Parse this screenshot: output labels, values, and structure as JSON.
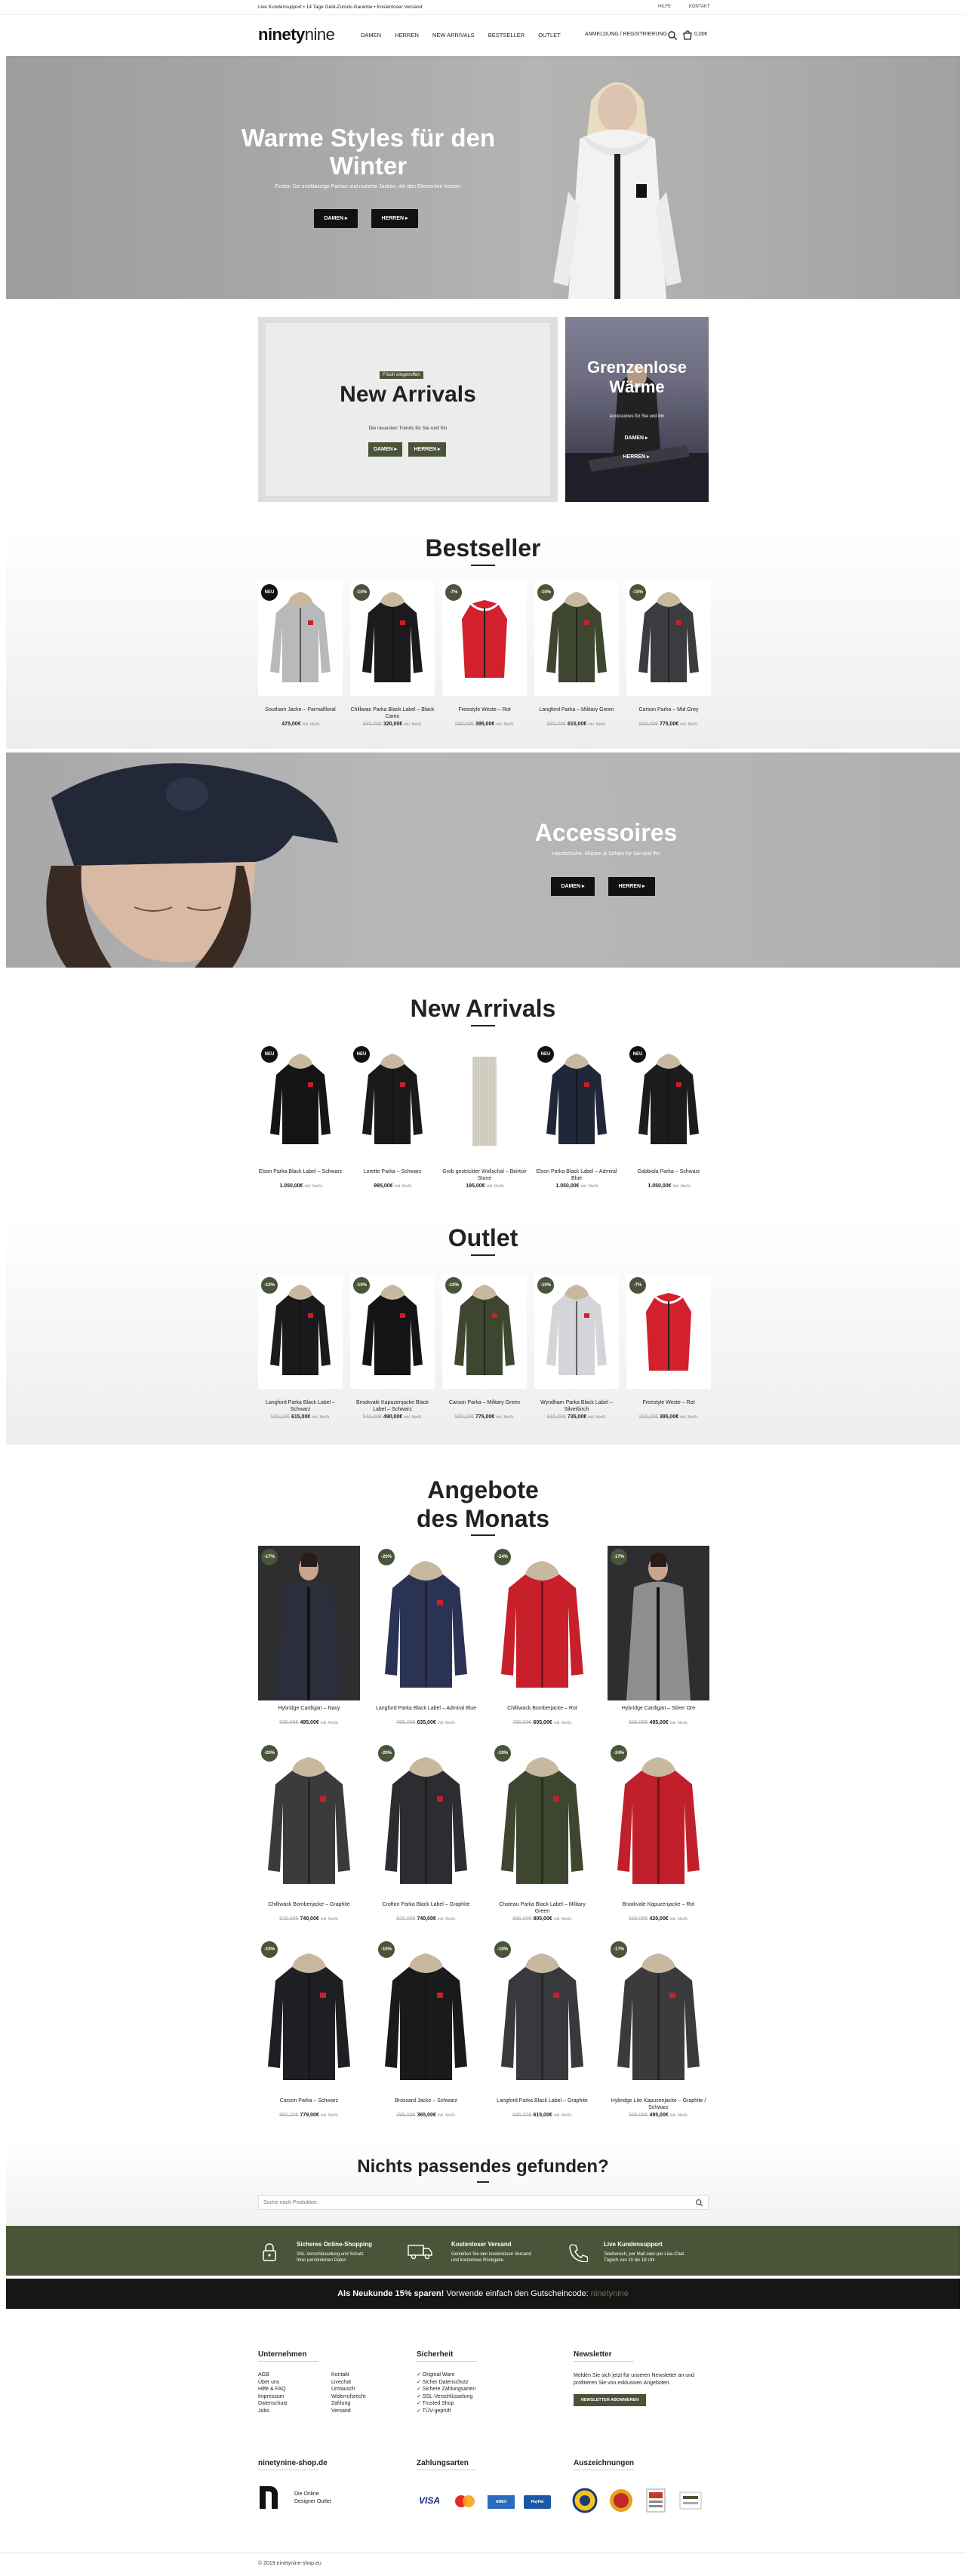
{
  "topbar": {
    "message": "Live Kundensupport • 14 Tage Geld-Zurück-Garantie • Kostenloser Versand",
    "link_help": "HILFE",
    "link_contact": "KONTAKT"
  },
  "header": {
    "logo_bold": "ninety",
    "logo_light": "nine",
    "nav": [
      "DAMEN",
      "HERREN",
      "NEW ARRIVALS",
      "BESTSELLER",
      "OUTLET"
    ],
    "account": "ANMELDUNG / REGISTRIERUNG",
    "cart_total": "0,00€"
  },
  "hero": {
    "title": "Warme Styles für den Winter",
    "subtitle": "Finden Sie erstklassige Parkas und isolierte Jacken, die den Elementen trotzen.",
    "btn_women": "DAMEN ▸",
    "btn_men": "HERREN ▸"
  },
  "new_arrivals_promo": {
    "tag": "Frisch eingetroffen",
    "title": "New Arrivals",
    "subtitle": "Die neuesten Trends für Sie und Ihn",
    "btn_women": "DAMEN ▸",
    "btn_men": "HERREN ▸"
  },
  "warmth_promo": {
    "title": "Grenzenlose Wärme",
    "subtitle": "Accessoires für Sie und Ihn",
    "btn_women": "DAMEN ▸",
    "btn_men": "HERREN ▸"
  },
  "bestseller": {
    "title": "Bestseller",
    "products": [
      {
        "badge": "NEU",
        "name": "Southam Jacke – Parmalfloral",
        "old": "",
        "price": "475,00€",
        "tax": "inkl. MwSt."
      },
      {
        "badge": "-10%",
        "name": "Chilliwac Parka Black Label – Black Camo",
        "old": "885,00€",
        "price": "320,00€",
        "tax": "inkl. MwSt."
      },
      {
        "badge": "-7%",
        "name": "Freestyle Weste – Rot",
        "old": "295,00€",
        "price": "395,00€",
        "tax": "inkl. MwSt."
      },
      {
        "badge": "-10%",
        "name": "Langford Parka – Military Green",
        "old": "685,00€",
        "price": "615,00€",
        "tax": "inkl. MwSt."
      },
      {
        "badge": "-10%",
        "name": "Carson Parka – Mid Grey",
        "old": "865,00€",
        "price": "775,00€",
        "tax": "inkl. MwSt."
      }
    ]
  },
  "accessories": {
    "title": "Accessoires",
    "subtitle": "Handschuhe, Mützen & Schals für Sie und Ihn",
    "btn_women": "DAMEN ▸",
    "btn_men": "HERREN ▸"
  },
  "new_arrivals": {
    "title": "New Arrivals",
    "products": [
      {
        "badge": "NEU",
        "name": "Elson Parka Black Label – Schwarz",
        "old": "",
        "price": "1.050,00€",
        "tax": "inkl. MwSt."
      },
      {
        "badge": "NEU",
        "name": "Lorette Parka – Schwarz",
        "old": "",
        "price": "995,00€",
        "tax": "inkl. MwSt."
      },
      {
        "badge": "",
        "name": "Grob gestrickter Wollschal – Beirtoir Stone",
        "old": "",
        "price": "195,00€",
        "tax": "inkl. MwSt."
      },
      {
        "badge": "NEU",
        "name": "Elson Parka Black Label – Admiral Blue",
        "old": "",
        "price": "1.050,00€",
        "tax": "inkl. MwSt."
      },
      {
        "badge": "NEU",
        "name": "Gabbiola Parka – Schwarz",
        "old": "",
        "price": "1.050,00€",
        "tax": "inkl. MwSt."
      }
    ]
  },
  "outlet": {
    "title": "Outlet",
    "products": [
      {
        "badge": "-10%",
        "name": "Langford Parka Black Label – Schwarz",
        "old": "685,00€",
        "price": "615,00€",
        "tax": "inkl. MwSt."
      },
      {
        "badge": "-10%",
        "name": "Brookvale Kapuzenjacke Black Label – Schwarz",
        "old": "545,00€",
        "price": "490,00€",
        "tax": "inkl. MwSt."
      },
      {
        "badge": "-10%",
        "name": "Carson Parka – Military Green",
        "old": "865,00€",
        "price": "775,00€",
        "tax": "inkl. MwSt."
      },
      {
        "badge": "-10%",
        "name": "Wyndham Parka Black Label – Silverbirch",
        "old": "815,00€",
        "price": "735,00€",
        "tax": "inkl. MwSt."
      },
      {
        "badge": "-7%",
        "name": "Freestyle Weste – Rot",
        "old": "295,00€",
        "price": "395,00€",
        "tax": "inkl. MwSt."
      }
    ]
  },
  "deals": {
    "title_line1": "Angebote",
    "title_line2": "des Monats",
    "products": [
      {
        "badge": "-17%",
        "name": "Hybridge Cardigan – Navy",
        "old": "595,00€",
        "price": "495,00€",
        "tax": "inkl. MwSt.",
        "c": "#2b2f3c",
        "photo": true
      },
      {
        "badge": "-20%",
        "name": "Langford Parka Black Label – Admiral Blue",
        "old": "795,00€",
        "price": "635,00€",
        "tax": "inkl. MwSt.",
        "c": "#2a3353",
        "photo": false
      },
      {
        "badge": "-24%",
        "name": "Chilliwack Bomberjacke – Rot",
        "old": "795,00€",
        "price": "605,00€",
        "tax": "inkl. MwSt.",
        "c": "#c8202b",
        "photo": false
      },
      {
        "badge": "-17%",
        "name": "Hybridge Cardigan – Silver Ore",
        "old": "595,00€",
        "price": "495,00€",
        "tax": "inkl. MwSt.",
        "c": "#8e8e8e",
        "photo": true
      },
      {
        "badge": "-20%",
        "name": "Chilliwack Bomberjacke – Graphite",
        "old": "925,00€",
        "price": "740,00€",
        "tax": "inkl. MwSt.",
        "c": "#3a3b3d",
        "photo": false
      },
      {
        "badge": "-20%",
        "name": "Crofton Parka Black Label – Graphite",
        "old": "925,00€",
        "price": "740,00€",
        "tax": "inkl. MwSt.",
        "c": "#2c2d30",
        "photo": false
      },
      {
        "badge": "-10%",
        "name": "Chateau Parka Black Label – Military Green",
        "old": "895,00€",
        "price": "805,00€",
        "tax": "inkl. MwSt.",
        "c": "#3e4630",
        "photo": false
      },
      {
        "badge": "-24%",
        "name": "Brookvale Kapuzenjacke – Rot",
        "old": "555,00€",
        "price": "420,00€",
        "tax": "inkl. MwSt.",
        "c": "#c11f2b",
        "photo": false
      },
      {
        "badge": "-10%",
        "name": "Carson Parka – Schwarz",
        "old": "865,00€",
        "price": "779,00€",
        "tax": "inkl. MwSt.",
        "c": "#1e1f22",
        "photo": false
      },
      {
        "badge": "-10%",
        "name": "Brossard Jacke – Schwarz",
        "old": "395,00€",
        "price": "365,00€",
        "tax": "inkl. MwSt.",
        "c": "#1a1a1c",
        "photo": false
      },
      {
        "badge": "-10%",
        "name": "Langford Parka Black Label – Graphite",
        "old": "685,00€",
        "price": "615,00€",
        "tax": "inkl. MwSt.",
        "c": "#38393c",
        "photo": false
      },
      {
        "badge": "-17%",
        "name": "Hybridge Lite Kapuzenjacke – Graphite / Schwarz",
        "old": "595,00€",
        "price": "495,00€",
        "tax": "inkl. MwSt.",
        "c": "#3b3b3e",
        "photo": false
      }
    ]
  },
  "notfound": {
    "title": "Nichts passendes gefunden?",
    "placeholder": "Suche nach Produkten"
  },
  "trust": [
    {
      "title": "Sicheres Online-Shopping",
      "text": "SSL-Verschlüsselung und Schutz Ihrer persönlichen Daten"
    },
    {
      "title": "Kostenloser Versand",
      "text": "Genießen Sie den kostenlosen Versand und kostenlose Rückgabe"
    },
    {
      "title": "Live Kundensupport",
      "text": "Telefonisch, per Mail oder per Live-Chat: Täglich von 10 bis 18 Uhr"
    }
  ],
  "promo": {
    "text": "Als Neukunde 15% sparen!",
    "text2": "Vorwende einfach den Gutscheincode:",
    "code": "ninetynine"
  },
  "footer": {
    "company_title": "Unternehmen",
    "company_col1": [
      "AGB",
      "Über uns",
      "Hilfe & FAQ",
      "Impressum",
      "Datenschutz",
      "Jobs"
    ],
    "company_col2": [
      "Kontakt",
      "Livechat",
      "Umtausch",
      "Widerrufsrecht",
      "Zahlung",
      "Versand"
    ],
    "security_title": "Sicherheit",
    "security_items": [
      "✓ Original Ware",
      "✓ Sicher Datenschutz",
      "✓ Sichere Zahlungsarten",
      "✓ SSL-Verschlüsselung",
      "✓ Trusted Shop",
      "✓ TÜV-geprüft"
    ],
    "newsletter_title": "Newsletter",
    "newsletter_text": "Melden Sie sich jetzt für unseren Newsletter an und profitieren Sie von exklusiven Angeboten.",
    "newsletter_btn": "NEWSLETTER ABONNIEREN",
    "shop_title": "ninetynine-shop.de",
    "shop_line1": "Die Online",
    "shop_line2": "Designer Outlet",
    "payment_title": "Zahlungsarten",
    "awards_title": "Auszeichnungen",
    "copyright": "© 2019 ninetynine-shop.eu"
  },
  "colors": {
    "accent": "#4a5438",
    "dark": "#161616",
    "badge_black": "#111111",
    "badge_olive": "#4a5438"
  }
}
